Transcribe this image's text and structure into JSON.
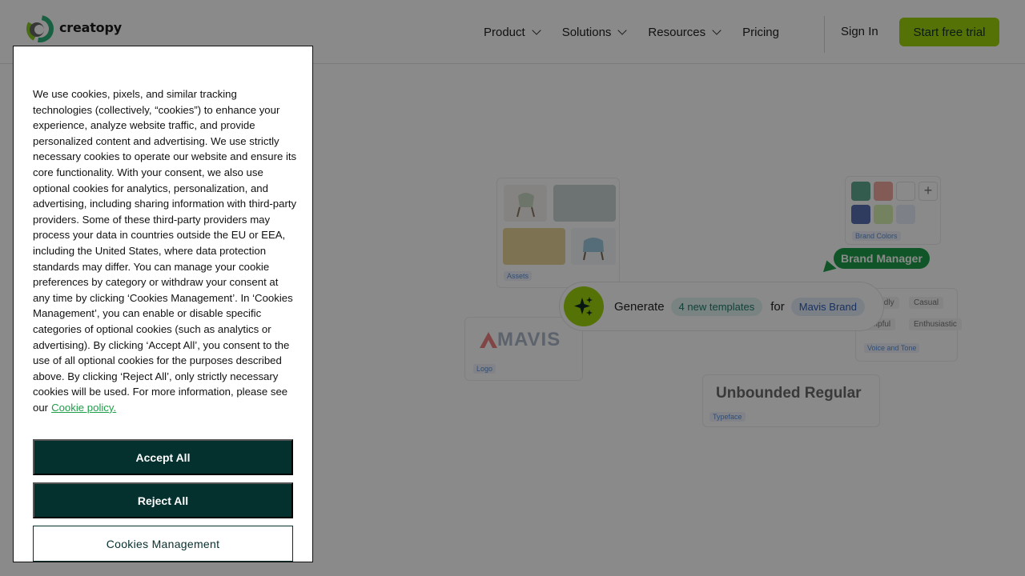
{
  "header": {
    "brand": "creatopy",
    "nav": [
      {
        "label": "Product",
        "has_dropdown": true
      },
      {
        "label": "Solutions",
        "has_dropdown": true
      },
      {
        "label": "Resources",
        "has_dropdown": true
      },
      {
        "label": "Pricing",
        "has_dropdown": false
      }
    ],
    "signin_label": "Sign In",
    "cta_label": "Start free trial",
    "cta_color": "#9bd30a"
  },
  "hero": {
    "assets_tag": "Assets",
    "logo_text": "MAVIS",
    "logo_tag": "Logo",
    "brand_colors_tag": "Brand Colors",
    "brand_manager_badge": "Brand Manager",
    "generate": {
      "prefix": "Generate",
      "templates_chip": "4 new templates",
      "for": "for",
      "brand_chip": "Mavis Brand"
    },
    "tones": [
      "Friendly",
      "Casual",
      "Helpful",
      "Enthusiastic"
    ],
    "voice_tag": "Voice and Tone",
    "typeface_text": "Unbounded Regular",
    "typeface_tag": "Typeface",
    "swatch_colors": [
      "#5fa890",
      "#f0a8a0",
      "#ffffff",
      "#5a6fb0",
      "#d6f0b0",
      "#e8eefa"
    ]
  },
  "cookie_modal": {
    "body": "We use cookies, pixels, and similar tracking technologies (collectively, “cookies”) to enhance your experience, analyze website traffic, and provide personalized content and advertising. We use strictly necessary cookies to operate our website and ensure its core functionality. With your consent, we also use optional cookies for analytics, personalization, and advertising, including sharing information with third-party providers. Some of these third-party providers may process your data in countries outside the EU or EEA, including the United States, where data protection standards may differ. You can manage your cookie preferences by category or withdraw your consent at any time by clicking ‘Cookies Management’. In ‘Cookies Management’, you can enable or disable specific categories of optional cookies (such as analytics or advertising). By clicking ‘Accept All’, you consent to the use of all optional cookies for the purposes described above. By clicking ‘Reject All’, only strictly necessary cookies will be used. For more information, please see our",
    "policy_link": "Cookie policy.",
    "accept_label": "Accept All",
    "reject_label": "Reject All",
    "manage_label": "Cookies Management",
    "button_color": "#04302e"
  }
}
